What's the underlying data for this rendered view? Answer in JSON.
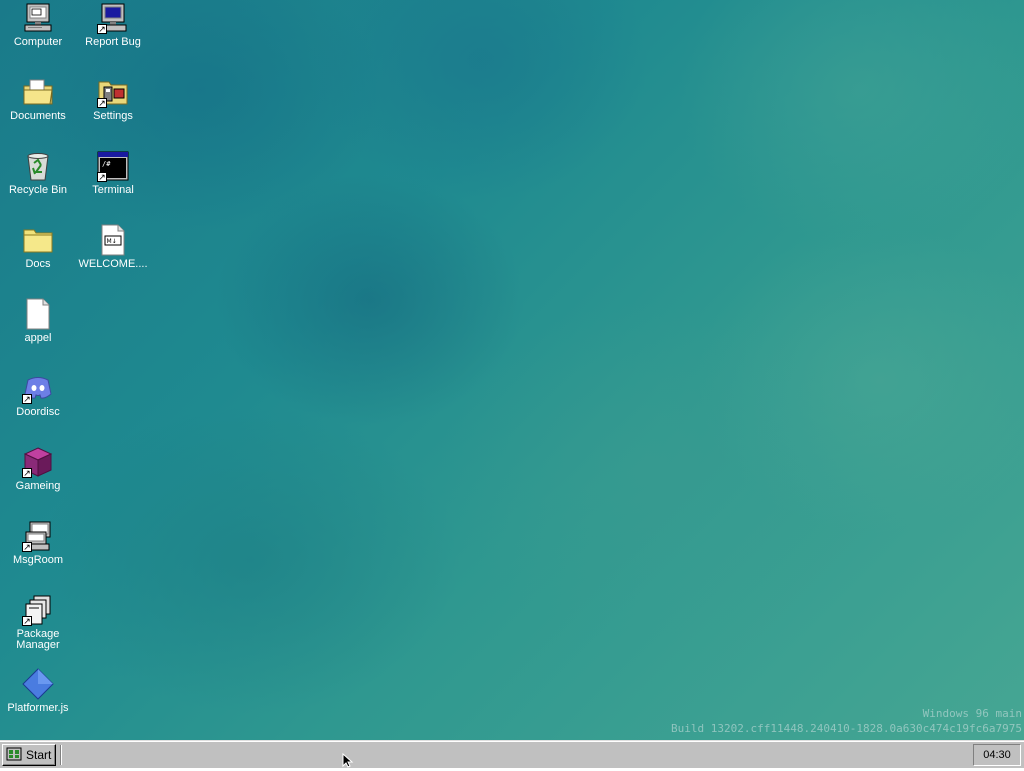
{
  "desktop": {
    "icons": {
      "computer": "Computer",
      "report_bug": "Report Bug",
      "documents": "Documents",
      "settings": "Settings",
      "recycle_bin": "Recycle Bin",
      "terminal": "Terminal",
      "docs": "Docs",
      "welcome": "WELCOME....",
      "appel": "appel",
      "doordisc": "Doordisc",
      "gameing": "Gameing",
      "msgroom": "MsgRoom",
      "package_manager": "Package Manager",
      "platformer": "Platformer.js"
    },
    "watermark": {
      "line1": "Windows 96 main",
      "line2": "Build 13202.cff11448.240410-1828.0a630c474c19fc6a7975"
    }
  },
  "taskbar": {
    "start_label": "Start",
    "clock": "04:30"
  },
  "colors": {
    "taskbar": "#c0c0c0",
    "desktop_accent": "#1f8a90"
  }
}
